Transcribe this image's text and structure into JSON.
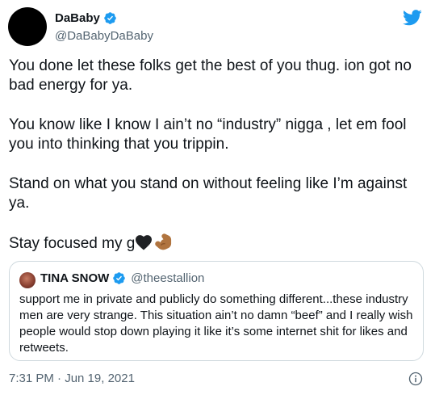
{
  "author": {
    "name": "DaBaby",
    "handle": "@DaBabyDaBaby"
  },
  "tweet": {
    "paragraphs": [
      "You done let these folks get the best of you thug. ion got no bad energy for ya.",
      "You know like I know I ain’t no “industry” nigga , let em fool you into thinking that you trippin.",
      "Stand on what you stand on without feeling like I’m against ya.",
      "Stay focused my g"
    ],
    "emojis": [
      "black-heart",
      "flexed-biceps"
    ]
  },
  "quote": {
    "name": "TINA SNOW",
    "handle": "@theestallion",
    "text": "support me in private and publicly do something different...these industry men are very strange. This situation ain’t no damn “beef” and I really wish people would stop down playing it like it’s some internet shit for likes and retweets."
  },
  "footer": {
    "timestamp": "7:31 PM · Jun 19, 2021"
  },
  "colors": {
    "verified": "#1d9bf0",
    "twitter_brand": "#1d9bf0",
    "secondary_text": "#536471",
    "border": "#cfd9de"
  }
}
